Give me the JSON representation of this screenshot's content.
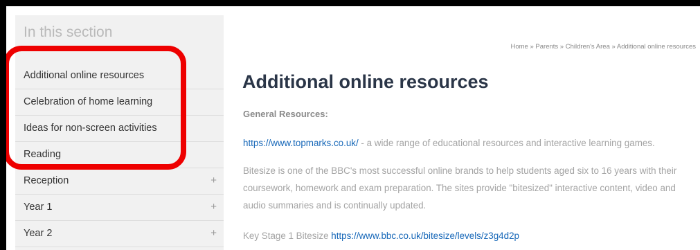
{
  "sidebar": {
    "title": "In this section",
    "items": [
      {
        "label": "Additional online resources",
        "expandable": false
      },
      {
        "label": "Celebration of home learning",
        "expandable": false
      },
      {
        "label": "Ideas for non-screen activities",
        "expandable": false
      },
      {
        "label": "Reading",
        "expandable": false
      },
      {
        "label": "Reception",
        "expandable": true,
        "toggle": "+"
      },
      {
        "label": "Year 1",
        "expandable": true,
        "toggle": "+"
      },
      {
        "label": "Year 2",
        "expandable": true,
        "toggle": "+"
      }
    ]
  },
  "breadcrumb": {
    "home": "Home",
    "sep": "»",
    "parents": "Parents",
    "childrens_area": "Children's Area",
    "current": "Additional online resources"
  },
  "main": {
    "title": "Additional online resources",
    "subheading": "General Resources:",
    "topmarks_link": "https://www.topmarks.co.uk/",
    "topmarks_desc": " - a wide range of educational resources and interactive learning games.",
    "bitesize_text": "Bitesize is one of the BBC's most successful online brands to help students aged six to 16 years with their coursework, homework and exam preparation. The sites provide \"bitesized\" interactive content, video and audio summaries and is continually updated.",
    "ks1_label": "Key Stage 1 Bitesize ",
    "ks1_link": "https://www.bbc.co.uk/bitesize/levels/z3g4d2p"
  },
  "colors": {
    "highlight": "#ee0000",
    "link": "#1667b8",
    "title": "#2a3547"
  }
}
